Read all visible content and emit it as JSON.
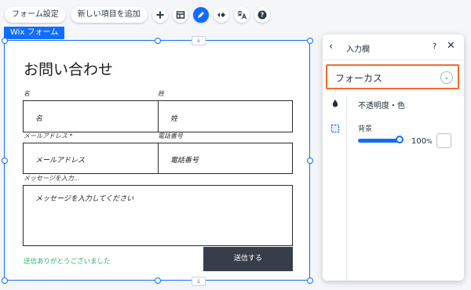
{
  "toolbar": {
    "form_settings_label": "フォーム設定",
    "add_item_label": "新しい項目を追加",
    "buttons": [
      "add-icon",
      "layout-icon",
      "design-pen-icon",
      "animation-icon",
      "translate-icon",
      "help-icon"
    ]
  },
  "form": {
    "badge": "Wix フォーム",
    "title": "お問い合わせ",
    "fields": {
      "first_name_label": "名",
      "first_name_placeholder": "名",
      "last_name_label": "姓",
      "last_name_placeholder": "姓",
      "email_label": "メールアドレス *",
      "email_placeholder": "メールアドレス",
      "phone_label": "電話番号",
      "phone_placeholder": "電話番号",
      "message_label": "メッセージを入力...",
      "message_placeholder": "メッセージを入力してください"
    },
    "thanks_message": "送信ありがとうございました",
    "submit_label": "送信する",
    "colors": {
      "accent": "#116dff",
      "submit_bg": "#383e49",
      "thanks": "#2fb36a"
    }
  },
  "panel": {
    "title": "入力欄",
    "help": "?",
    "state_dropdown_value": "フォーカス",
    "highlight_color": "#f36b2f",
    "section_title": "不透明度・色",
    "background_label": "背景",
    "opacity_value": "100",
    "opacity_unit": "%",
    "opacity_fraction": 1.0,
    "swatch_color": "#ffffff"
  }
}
